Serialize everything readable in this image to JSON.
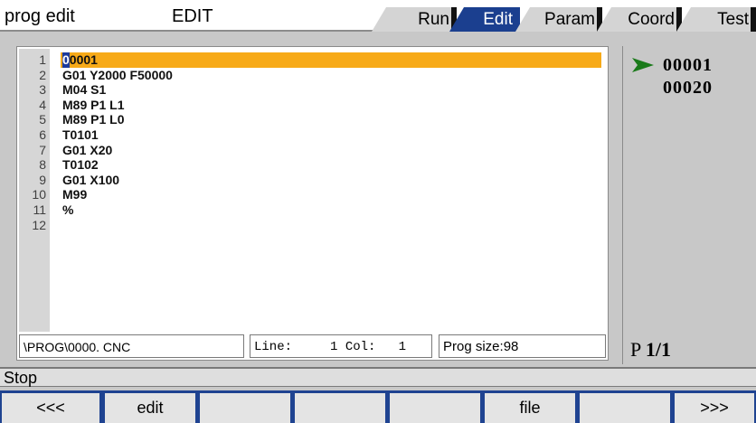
{
  "header": {
    "title": "prog edit",
    "mode": "EDIT",
    "tabs": [
      {
        "label": "Run",
        "active": false
      },
      {
        "label": "Edit",
        "active": true
      },
      {
        "label": "Param",
        "active": false
      },
      {
        "label": "Coord",
        "active": false
      },
      {
        "label": "Test",
        "active": false
      }
    ]
  },
  "editor": {
    "cursor_char": "0",
    "lines": [
      {
        "n": "1",
        "code": "0001",
        "current": true
      },
      {
        "n": "2",
        "code": "G01 Y2000 F50000"
      },
      {
        "n": "3",
        "code": "M04 S1"
      },
      {
        "n": "4",
        "code": "M89 P1 L1"
      },
      {
        "n": "5",
        "code": "M89 P1 L0"
      },
      {
        "n": "6",
        "code": "T0101"
      },
      {
        "n": "7",
        "code": "G01 X20"
      },
      {
        "n": "8",
        "code": "T0102"
      },
      {
        "n": "9",
        "code": "G01 X100"
      },
      {
        "n": "10",
        "code": "M99"
      },
      {
        "n": "11",
        "code": "%"
      },
      {
        "n": "12",
        "code": ""
      }
    ]
  },
  "status": {
    "path": "\\PROG\\0000. CNC",
    "line_col": "Line:     1 Col:   1",
    "prog_size": "Prog size:98"
  },
  "programs": {
    "items": [
      {
        "label": "00001",
        "selected": true
      },
      {
        "label": "00020",
        "selected": false
      }
    ],
    "page_prefix": "P ",
    "page": "1/1"
  },
  "machine_status": "Stop",
  "softkeys": [
    "<<<",
    "edit",
    "",
    "",
    "",
    "file",
    "",
    ">>>"
  ],
  "colors": {
    "accent": "#1b3f8f",
    "current_line": "#f7aa18",
    "arrow": "#1a7a1a"
  }
}
